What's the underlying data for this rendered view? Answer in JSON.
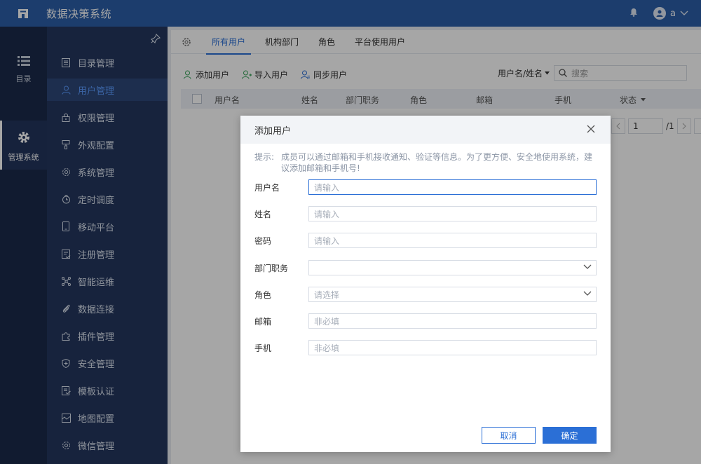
{
  "app": {
    "title": "数据决策系统",
    "user": "a"
  },
  "rail": [
    {
      "label": "目录",
      "icon": "list-icon"
    },
    {
      "label": "管理系统",
      "icon": "gear-icon"
    }
  ],
  "sidebar": {
    "items": [
      {
        "label": "目录管理"
      },
      {
        "label": "用户管理"
      },
      {
        "label": "权限管理"
      },
      {
        "label": "外观配置"
      },
      {
        "label": "系统管理"
      },
      {
        "label": "定时调度"
      },
      {
        "label": "移动平台"
      },
      {
        "label": "注册管理"
      },
      {
        "label": "智能运维"
      },
      {
        "label": "数据连接"
      },
      {
        "label": "插件管理"
      },
      {
        "label": "安全管理"
      },
      {
        "label": "模板认证"
      },
      {
        "label": "地图配置"
      },
      {
        "label": "微信管理"
      }
    ]
  },
  "tabs": [
    "所有用户",
    "机构部门",
    "角色",
    "平台使用用户"
  ],
  "toolbar": {
    "add": "添加用户",
    "import": "导入用户",
    "sync": "同步用户",
    "search_type": "用户名/姓名",
    "search_placeholder": "搜索"
  },
  "table": {
    "headers": [
      "用户名",
      "姓名",
      "部门职务",
      "角色",
      "邮箱",
      "手机",
      "状态"
    ]
  },
  "pager": {
    "page": "1",
    "total": "/1"
  },
  "modal": {
    "title": "添加用户",
    "tip_label": "提示:",
    "tip": "成员可以通过邮箱和手机接收通知、验证等信息。为了更方便、安全地使用系统，建议添加邮箱和手机号!",
    "fields": [
      {
        "label": "用户名",
        "placeholder": "请输入"
      },
      {
        "label": "姓名",
        "placeholder": "请输入"
      },
      {
        "label": "密码",
        "placeholder": "请输入"
      },
      {
        "label": "部门职务",
        "placeholder": ""
      },
      {
        "label": "角色",
        "placeholder": "请选择"
      },
      {
        "label": "邮箱",
        "placeholder": "非必填"
      },
      {
        "label": "手机",
        "placeholder": "非必填"
      }
    ],
    "cancel": "取消",
    "ok": "确定"
  },
  "colors": {
    "brand": "#2b5ea8",
    "accent": "#2b6fd6",
    "sidebar": "#24375e",
    "rail": "#1b2a4a"
  }
}
